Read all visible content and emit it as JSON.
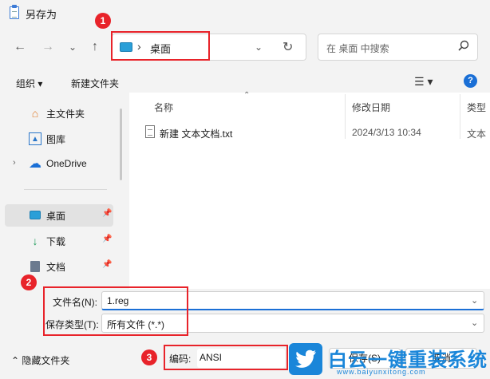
{
  "window": {
    "title": "另存为"
  },
  "address": {
    "separator": "›",
    "path": "桌面"
  },
  "search": {
    "placeholder": "在 桌面 中搜索"
  },
  "toolbar": {
    "organize": "组织 ▾",
    "new_folder": "新建文件夹"
  },
  "sidebar": {
    "items": [
      {
        "label": "主文件夹",
        "icon": "home-icon"
      },
      {
        "label": "图库",
        "icon": "gallery-icon"
      },
      {
        "label": "OneDrive",
        "icon": "cloud-icon"
      },
      {
        "label": "桌面",
        "icon": "desktop-icon",
        "selected": true
      },
      {
        "label": "下载",
        "icon": "download-icon"
      },
      {
        "label": "文档",
        "icon": "document-icon"
      }
    ]
  },
  "columns": {
    "name": "名称",
    "date": "修改日期",
    "type": "类型"
  },
  "files": [
    {
      "name": "新建 文本文档.txt",
      "date": "2024/3/13 10:34",
      "type": "文本"
    }
  ],
  "form": {
    "filename_label": "文件名(N):",
    "filename_value": "1.reg",
    "filetype_label": "保存类型(T):",
    "filetype_value": "所有文件  (*.*)",
    "hide_folders": "隐藏文件夹",
    "encoding_label": "编码:",
    "encoding_value": "ANSI",
    "save": "保存(S)",
    "cancel": "取消"
  },
  "annotations": [
    "1",
    "2",
    "3"
  ],
  "watermark": {
    "text": "白云一键重装系统",
    "url": "www.baiyunxitong.com"
  },
  "colors": {
    "accent": "#1a6fd6",
    "annotation": "#e8232a",
    "watermark": "#1a86d9"
  }
}
